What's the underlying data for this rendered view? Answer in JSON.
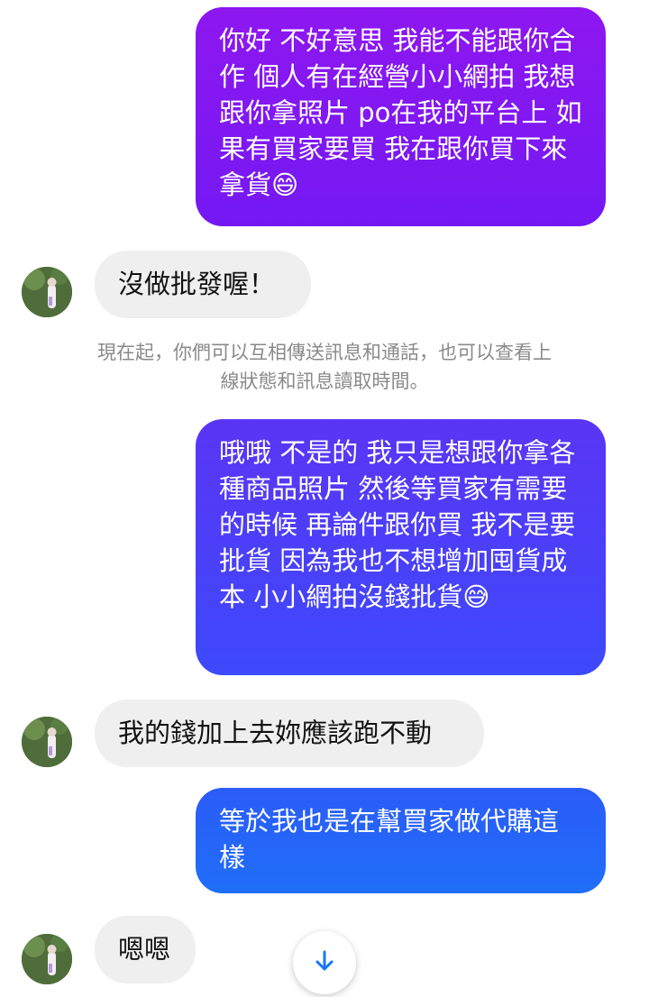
{
  "messages": {
    "outgoing_1": "你好 不好意思 我能不能跟你合作 個人有在經營小小網拍 我想跟你拿照片 po在我的平台上 如果有買家要買 我在跟你買下來拿貨😄",
    "incoming_1": "沒做批發喔！",
    "system_notice": "現在起，你們可以互相傳送訊息和通話，也可以查看上線狀態和訊息讀取時間。",
    "outgoing_2": "哦哦 不是的 我只是想跟你拿各種商品照片 然後等買家有需要的時候 再論件跟你買 我不是要批貨 因為我也不想增加囤貨成本 小小網拍沒錢批貨😅",
    "incoming_2": "我的錢加上去妳應該跑不動",
    "outgoing_3": "等於我也是在幫買家做代購這樣",
    "incoming_3": "嗯嗯"
  },
  "icons": {
    "avatar": "contact-avatar",
    "scroll": "arrow-down-icon"
  },
  "colors": {
    "outgoing_top": "#8e17f0",
    "outgoing_mid": "#4a40f8",
    "outgoing_bottom": "#1f6ef8",
    "incoming_bg": "#efefef",
    "accent": "#1877f2"
  }
}
